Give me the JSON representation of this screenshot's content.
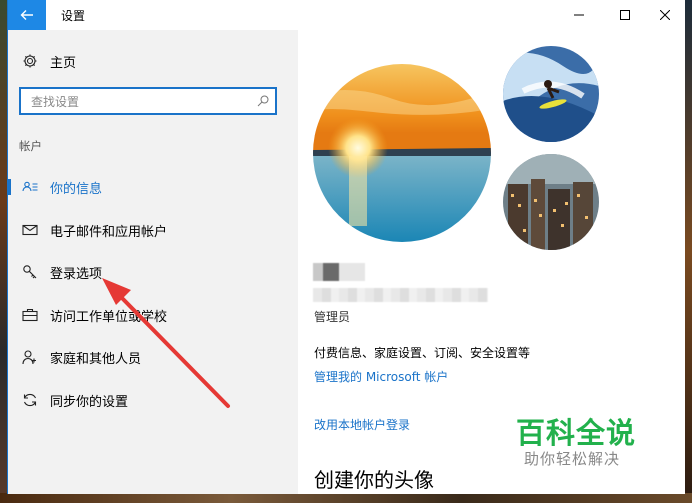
{
  "window": {
    "title": "设置",
    "controls": [
      "minimize-icon",
      "maximize-icon",
      "close-icon"
    ]
  },
  "sidebar": {
    "home_label": "主页",
    "search_placeholder": "查找设置",
    "section_label": "帐户",
    "items": [
      {
        "label": "你的信息",
        "icon": "person-list-icon",
        "active": true
      },
      {
        "label": "电子邮件和应用帐户",
        "icon": "mail-icon",
        "active": false
      },
      {
        "label": "登录选项",
        "icon": "key-icon",
        "active": false
      },
      {
        "label": "访问工作单位或学校",
        "icon": "briefcase-icon",
        "active": false
      },
      {
        "label": "家庭和其他人员",
        "icon": "person-add-icon",
        "active": false
      },
      {
        "label": "同步你的设置",
        "icon": "sync-icon",
        "active": false
      }
    ]
  },
  "content": {
    "role": "管理员",
    "billing_text": "付费信息、家庭设置、订阅、安全设置等",
    "manage_link": "管理我的 Microsoft 帐户",
    "local_login_link": "改用本地帐户登录",
    "create_avatar_title": "创建你的头像"
  },
  "watermark": {
    "main": "百科全说",
    "sub": "助你轻松解决"
  },
  "colors": {
    "accent": "#1a73c9",
    "sidebar_bg": "#f2f2f2",
    "arrow": "#e53935",
    "watermark_green": "#22b14c"
  }
}
